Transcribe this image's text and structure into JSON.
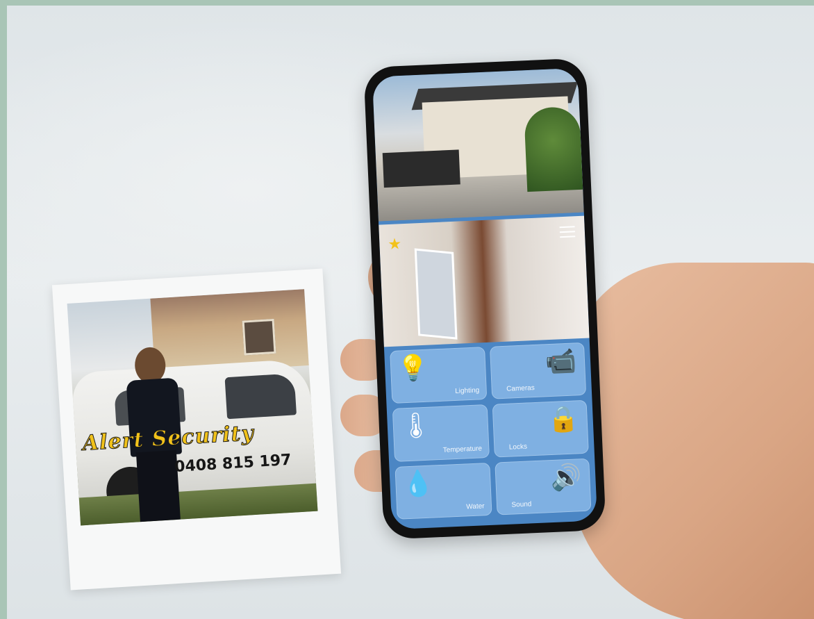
{
  "polaroid": {
    "car_brand_text": "Alert Security",
    "car_phone_text": "0408 815 197"
  },
  "app": {
    "tiles": [
      {
        "label": "Lighting",
        "icon": "lightbulb-icon",
        "glyph": "💡"
      },
      {
        "label": "Cameras",
        "icon": "camera-icon",
        "glyph": "📹"
      },
      {
        "label": "Temperature",
        "icon": "thermometer-icon",
        "glyph": "🌡"
      },
      {
        "label": "Locks",
        "icon": "lock-icon",
        "glyph": "🔒"
      },
      {
        "label": "Water",
        "icon": "water-drop-icon",
        "glyph": "💧"
      },
      {
        "label": "Sound",
        "icon": "speaker-icon",
        "glyph": "🔊"
      }
    ],
    "star_glyph": "★",
    "colors": {
      "accent": "#4b86c4",
      "tile": "#7fb0e2",
      "star": "#f2c21b"
    }
  }
}
